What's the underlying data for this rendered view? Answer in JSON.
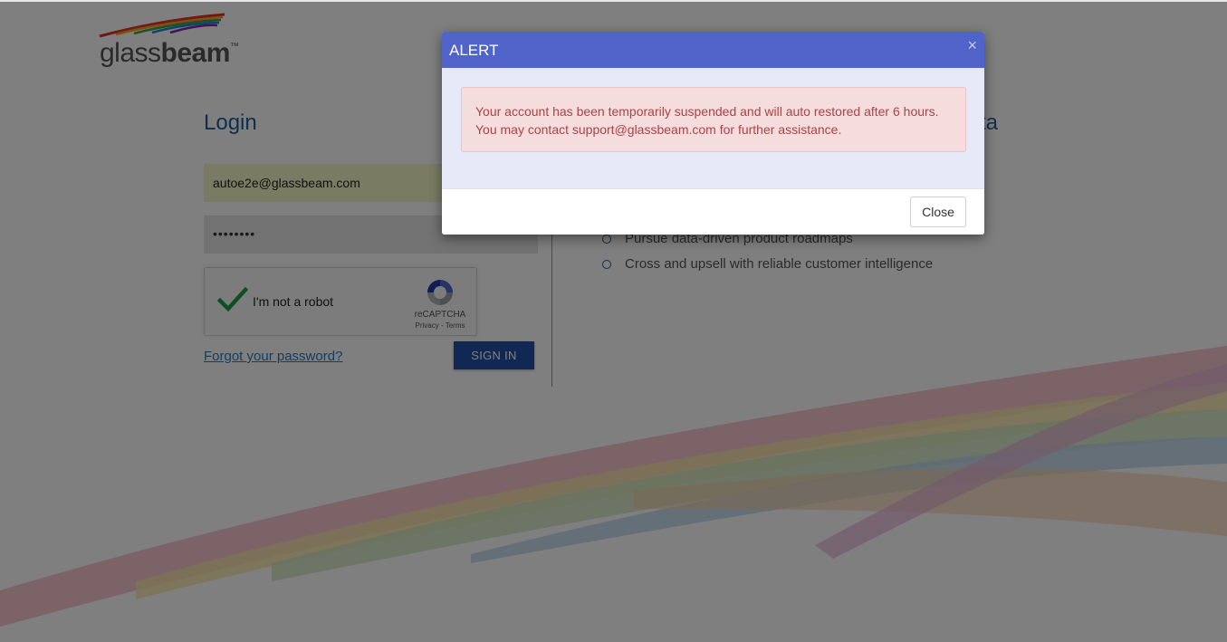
{
  "brand": {
    "logo_light": "glass",
    "logo_bold": "beam",
    "logo_tm": "™"
  },
  "login": {
    "title": "Login",
    "email_value": "autoe2e@glassbeam.com",
    "password_mask": "••••••••",
    "forgot_label": "Forgot your password?",
    "signin_label": "SIGN IN"
  },
  "recaptcha": {
    "label": "I'm not a robot",
    "brand": "reCAPTCHA",
    "links": "Privacy - Terms",
    "checked": true
  },
  "right_panel": {
    "title_partial": "ta",
    "features": [
      "Pursue data-driven product roadmaps",
      "Cross and upsell with reliable customer intelligence"
    ]
  },
  "modal": {
    "title": "ALERT",
    "close_glyph": "×",
    "message_line1": "Your account has been temporarily suspended and will auto restored after 6 hours.",
    "message_line2": "You may contact support@glassbeam.com for further assistance.",
    "close_label": "Close"
  },
  "colors": {
    "accent_blue": "#1f5f99",
    "modal_header": "#4f63c8",
    "signin_button": "#2450a8",
    "alert_text": "#a94448",
    "alert_bg": "#f5dcdd"
  }
}
